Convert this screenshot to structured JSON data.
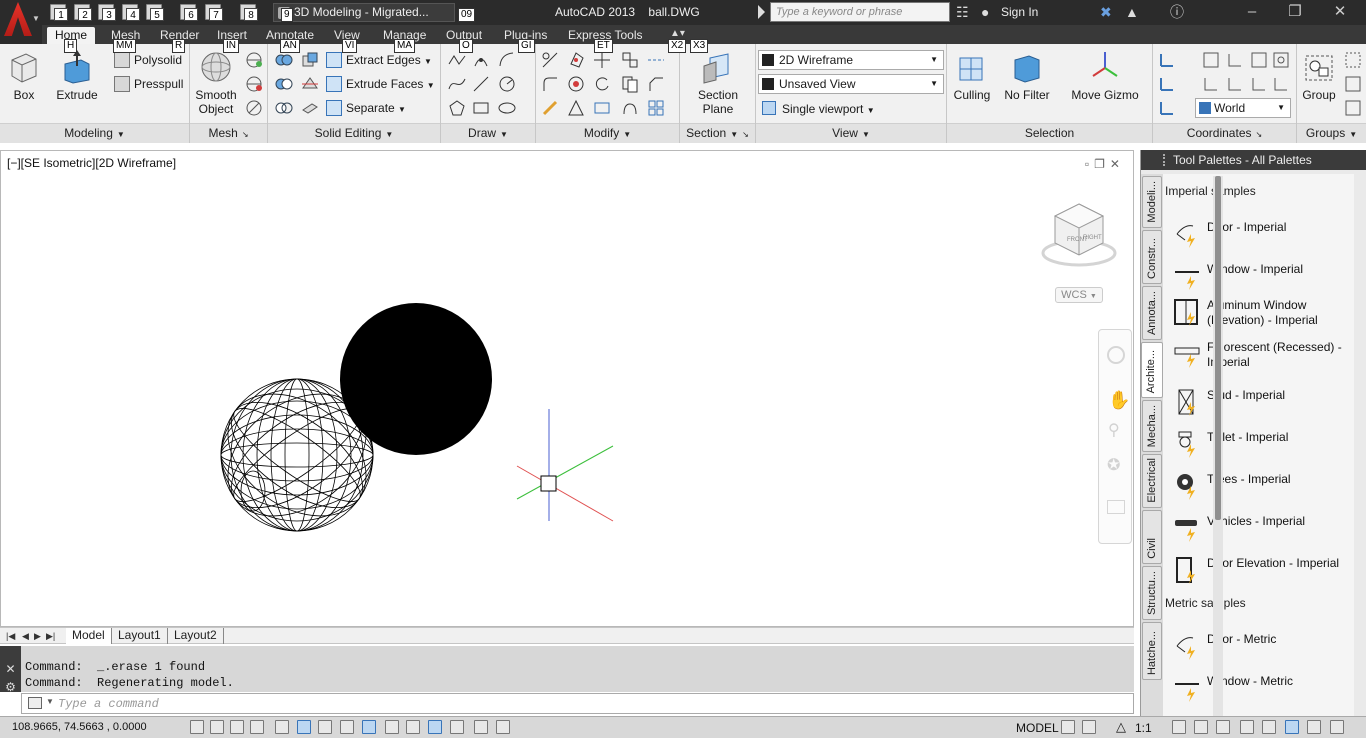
{
  "title_bar": {
    "app_title": "AutoCAD 2013",
    "file_name": "ball.DWG",
    "workspace": "3D Modeling - Migrated...",
    "search_placeholder": "Type a keyword or phrase",
    "sign_in": "Sign In",
    "quick_access_keytips": [
      "1",
      "2",
      "3",
      "4",
      "5",
      "6",
      "7",
      "8",
      "9",
      "09"
    ]
  },
  "ribbon_tabs": [
    {
      "label": "Home",
      "keytip": "H"
    },
    {
      "label": "Mesh",
      "keytip": "MM"
    },
    {
      "label": "Render",
      "keytip": "R"
    },
    {
      "label": "Insert",
      "keytip": "IN"
    },
    {
      "label": "Annotate",
      "keytip": "AN"
    },
    {
      "label": "View",
      "keytip": "VI"
    },
    {
      "label": "Manage",
      "keytip": "MA"
    },
    {
      "label": "Output",
      "keytip": "O"
    },
    {
      "label": "Plug-ins",
      "keytip": "GI"
    },
    {
      "label": "Express Tools",
      "keytip": "ET"
    }
  ],
  "extra_keytips": [
    "X2",
    "X3"
  ],
  "ribbon": {
    "modeling": {
      "title": "Modeling",
      "box": "Box",
      "extrude": "Extrude",
      "polysolid": "Polysolid",
      "presspull": "Presspull"
    },
    "mesh": {
      "title": "Mesh",
      "smooth_line1": "Smooth",
      "smooth_line2": "Object"
    },
    "solid_editing": {
      "title": "Solid Editing",
      "extract_edges": "Extract Edges",
      "extrude_faces": "Extrude Faces",
      "separate": "Separate"
    },
    "draw": {
      "title": "Draw"
    },
    "modify": {
      "title": "Modify"
    },
    "section": {
      "title": "Section",
      "plane_line1": "Section",
      "plane_line2": "Plane"
    },
    "view": {
      "title": "View",
      "visual_style": "2D Wireframe",
      "saved_view": "Unsaved View",
      "viewport": "Single viewport"
    },
    "selection": {
      "title": "Selection",
      "culling": "Culling",
      "no_filter": "No Filter",
      "move_gizmo": "Move Gizmo"
    },
    "coordinates": {
      "title": "Coordinates",
      "ucs": "World"
    },
    "groups": {
      "title": "Groups",
      "group": "Group"
    }
  },
  "viewport": {
    "label": "[−][SE Isometric][2D Wireframe]",
    "wcs": "WCS",
    "viewcube_faces": [
      "FRONT",
      "RIGHT"
    ]
  },
  "layout_tabs": [
    "Model",
    "Layout1",
    "Layout2"
  ],
  "command": {
    "history": [
      "Command:  _.erase 1 found",
      "Command:  Regenerating model."
    ],
    "placeholder": "Type a command"
  },
  "status_bar": {
    "coordinates": "108.9665, 74.5663 , 0.0000",
    "space": "MODEL",
    "scale": "1:1"
  },
  "tool_palette": {
    "title": "Tool Palettes - All Palettes",
    "tabs": [
      "Modeli...",
      "Constr...",
      "Annota...",
      "Archite...",
      "Mecha...",
      "Electrical",
      "Civil",
      "Structu...",
      "Hatche..."
    ],
    "active_tab": "Archite...",
    "sections": [
      {
        "heading": "Imperial samples",
        "items": [
          "Door - Imperial",
          "Window - Imperial",
          "Aluminum Window (Elevation) - Imperial",
          "Fluorescent (Recessed) - Imperial",
          "Stud - Imperial",
          "Toilet - Imperial",
          "Trees - Imperial",
          "Vehicles - Imperial",
          "Door Elevation - Imperial"
        ]
      },
      {
        "heading": "Metric samples",
        "items": [
          "Door - Metric",
          "Window - Metric"
        ]
      }
    ]
  },
  "colors": {
    "title_bar": "#2b2b2b",
    "ribbon": "#f1f1f1",
    "x_axis": "#e05050",
    "y_axis": "#3cbf3c",
    "z_axis": "#4a5fd0"
  }
}
